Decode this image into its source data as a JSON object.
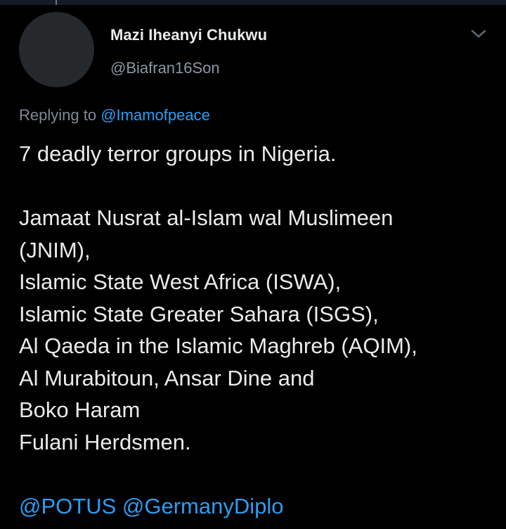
{
  "tweet": {
    "author_name": "Mazi Iheanyi Chukwu",
    "author_handle": "@Biafran16Son",
    "reply_prefix": "Replying to",
    "reply_to": "@Imamofpeace",
    "body_lines": [
      "7 deadly terror groups in Nigeria.",
      "",
      "Jamaat Nusrat al-Islam wal Muslimeen",
      "(JNIM),",
      "Islamic State West Africa (ISWA),",
      "Islamic State Greater Sahara (ISGS),",
      "Al Qaeda in the Islamic Maghreb (AQIM),",
      "Al Murabitoun, Ansar Dine and",
      "Boko Haram",
      "Fulani Herdsmen.",
      ""
    ],
    "mentions": [
      "@POTUS",
      "@GermanyDiplo"
    ]
  },
  "icons": {
    "menu": "chevron-down-icon"
  },
  "colors": {
    "background": "#000000",
    "text": "#e9ebec",
    "secondary_text": "#8b98a5",
    "link": "#2a9df4",
    "avatar_placeholder": "#26292c"
  }
}
